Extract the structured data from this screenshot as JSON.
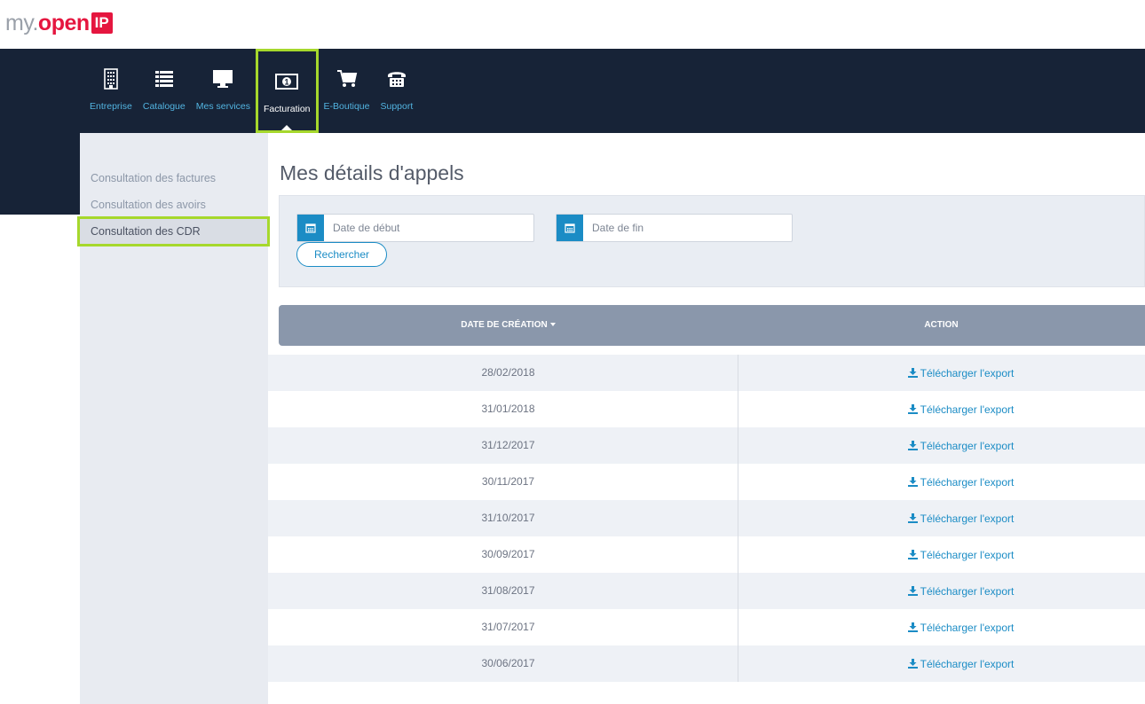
{
  "logo": {
    "my": "my.",
    "open": "open",
    "ip": "IP"
  },
  "nav": {
    "items": [
      {
        "label": "Entreprise",
        "icon": "building-icon"
      },
      {
        "label": "Catalogue",
        "icon": "list-icon"
      },
      {
        "label": "Mes services",
        "icon": "monitor-icon"
      },
      {
        "label": "Facturation",
        "icon": "banknote-icon",
        "active": true
      },
      {
        "label": "E-Boutique",
        "icon": "cart-icon"
      },
      {
        "label": "Support",
        "icon": "phone-icon"
      }
    ]
  },
  "sidebar": {
    "items": [
      {
        "label": "Consultation des factures"
      },
      {
        "label": "Consultation des avoirs"
      },
      {
        "label": "Consultation des CDR",
        "active": true
      }
    ]
  },
  "main": {
    "title": "Mes détails d'appels",
    "filters": {
      "start_placeholder": "Date de début",
      "end_placeholder": "Date de fin",
      "search_label": "Rechercher"
    },
    "table": {
      "columns": [
        "DATE DE CRÉATION",
        "ACTION"
      ],
      "action_label": "Télécharger l'export",
      "rows": [
        "28/02/2018",
        "31/01/2018",
        "31/12/2017",
        "30/11/2017",
        "31/10/2017",
        "30/09/2017",
        "31/08/2017",
        "31/07/2017",
        "30/06/2017"
      ]
    }
  },
  "colors": {
    "navbar": "#172337",
    "accent": "#1b8cc5",
    "highlight": "#a6d82c",
    "brand_red": "#e5163f"
  }
}
